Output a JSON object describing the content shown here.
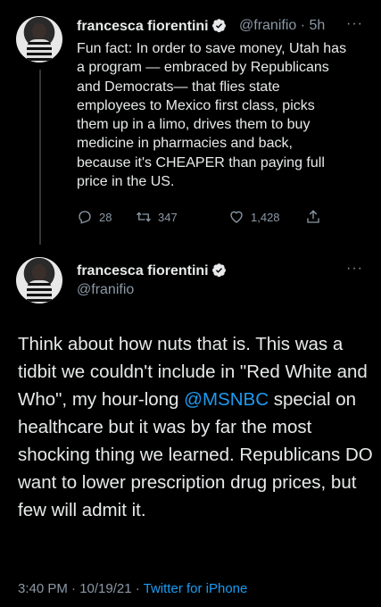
{
  "tweet1": {
    "author_name": "francesca fiorentini",
    "handle_time": "@franifio · 5h",
    "text": "Fun fact: In order to save money, Utah has\na program — embraced by Republicans\nand Democrats— that flies state\nemployees to Mexico first class, picks\nthem up in a limo, drives them to buy\nmedicine in pharmacies and back,\nbecause it's CHEAPER than paying full\nprice in the US.",
    "replies": "28",
    "retweets": "347",
    "likes": "1,428"
  },
  "tweet2": {
    "author_name": "francesca fiorentini",
    "handle": "@franifio",
    "text_before": "Think about how nuts that is. This was a tidbit we couldn't include in \"Red White and Who\", my hour-long ",
    "mention": "@MSNBC",
    "text_after": " special on healthcare but it was by far the most shocking thing we learned. Republicans DO want to lower prescription drug prices, but few will admit it.",
    "timestamp": "3:40 PM · 10/19/21 · ",
    "source": "Twitter for iPhone"
  },
  "more_glyph": "···",
  "colors": {
    "accent": "#1d9bf0",
    "muted": "#8b98a5",
    "background": "#000000"
  },
  "icons": [
    "verified-badge-icon",
    "reply-icon",
    "retweet-icon",
    "like-icon",
    "share-icon",
    "more-icon"
  ]
}
